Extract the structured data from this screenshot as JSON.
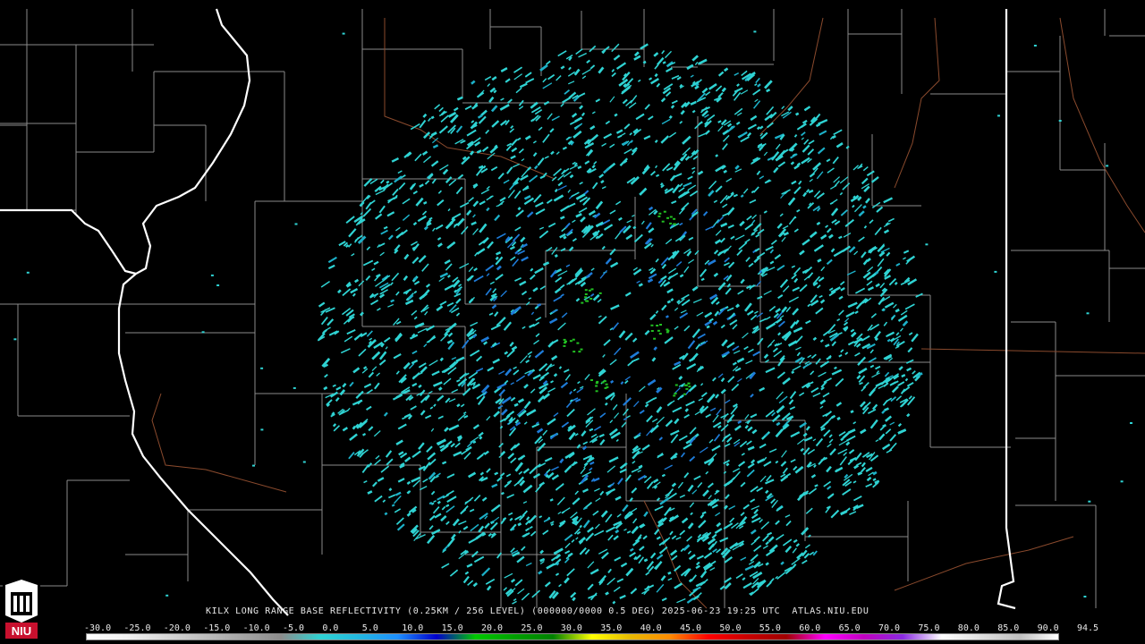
{
  "header": {
    "caption": "KILX LONG RANGE BASE REFLECTIVITY (0.25KM / 256 LEVEL) (000000/0000 0.5 DEG) 2025-06-23 19:25 UTC  ATLAS.NIU.EDU"
  },
  "logo": {
    "text": "NIU"
  },
  "colorscale": {
    "labels": [
      "-30.0",
      "-25.0",
      "-20.0",
      "-15.0",
      "-10.0",
      "-5.0",
      "0.0",
      "5.0",
      "10.0",
      "15.0",
      "20.0",
      "25.0",
      "30.0",
      "35.0",
      "40.0",
      "45.0",
      "50.0",
      "55.0",
      "60.0",
      "65.0",
      "70.0",
      "75.0",
      "80.0",
      "85.0",
      "90.0",
      "94.5"
    ],
    "colors": [
      "#ffffff",
      "#f2f2f2",
      "#d9d9d9",
      "#bfbfbf",
      "#a6a6a6",
      "#8c8c8c",
      "#2fd3d3",
      "#22b8e0",
      "#1e90ff",
      "#0000cd",
      "#00c800",
      "#00a000",
      "#008000",
      "#ffff00",
      "#e6b800",
      "#ff8c00",
      "#ff0000",
      "#c80000",
      "#a00000",
      "#ff00ff",
      "#c000c0",
      "#8a2be2",
      "#ffffff",
      "#e0e0e0",
      "#c0c0c0",
      "#ffffff"
    ]
  },
  "map_colors": {
    "background": "#000000",
    "county_lines": "#8a8a8a",
    "state_lines": "#ffffff",
    "roads": "#a0522d",
    "echo_primary": "#2fd3d3",
    "echo_secondary": "#1e7bd8",
    "echo_green": "#22c022"
  }
}
